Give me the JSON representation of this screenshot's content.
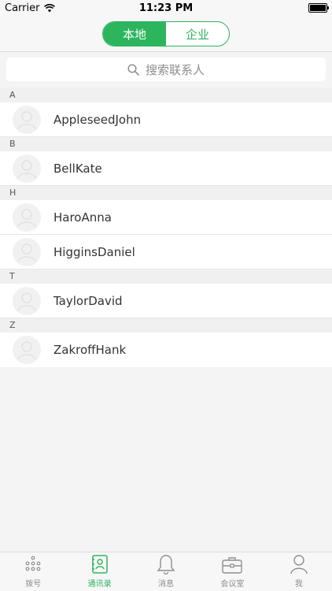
{
  "status_bar": {
    "carrier": "Carrier",
    "time": "11:23 PM"
  },
  "segmented": {
    "local": "本地",
    "enterprise": "企业"
  },
  "search": {
    "placeholder": "搜索联系人"
  },
  "sections": [
    {
      "letter": "A",
      "contacts": [
        "AppleseedJohn"
      ]
    },
    {
      "letter": "B",
      "contacts": [
        "BellKate"
      ]
    },
    {
      "letter": "H",
      "contacts": [
        "HaroAnna",
        "HigginsDaniel"
      ]
    },
    {
      "letter": "T",
      "contacts": [
        "TaylorDavid"
      ]
    },
    {
      "letter": "Z",
      "contacts": [
        "ZakroffHank"
      ]
    }
  ],
  "tabs": [
    {
      "label": "拨号",
      "icon": "dialpad-icon",
      "active": false
    },
    {
      "label": "通讯录",
      "icon": "contacts-book-icon",
      "active": true
    },
    {
      "label": "消息",
      "icon": "bell-icon",
      "active": false
    },
    {
      "label": "会议室",
      "icon": "briefcase-icon",
      "active": false
    },
    {
      "label": "我",
      "icon": "person-icon",
      "active": false
    }
  ],
  "colors": {
    "accent": "#2db55d",
    "inactive": "#8e8e93"
  }
}
